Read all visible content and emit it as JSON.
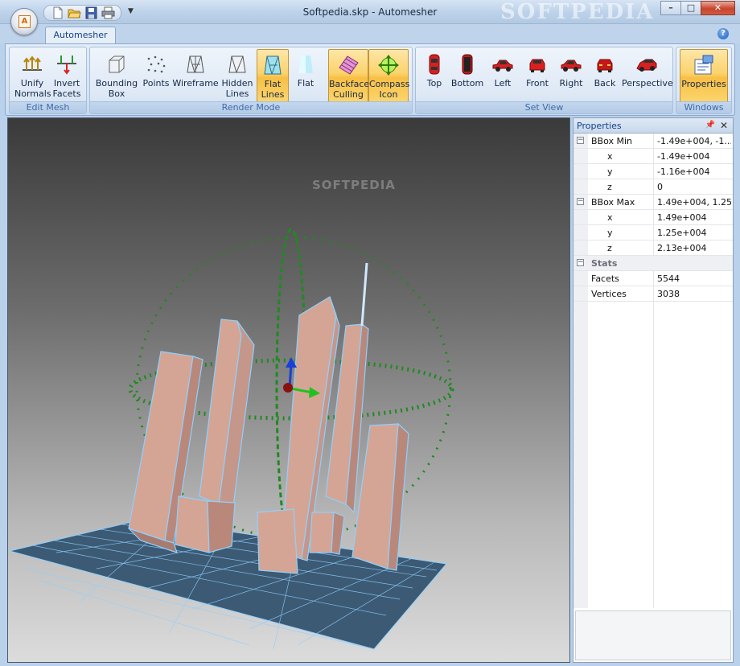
{
  "window": {
    "title": "Softpedia.skp - Automesher",
    "watermark": "SOFTPEDIA",
    "app_button_label": "A",
    "caption": {
      "minimize": "–",
      "maximize": "□",
      "close": "✕"
    }
  },
  "quick_access": [
    "new-doc-icon",
    "open-folder-icon",
    "save-icon",
    "print-icon"
  ],
  "ribbon": {
    "tab": "Automesher",
    "help": "?",
    "groups": {
      "edit_mesh": {
        "label": "Edit Mesh",
        "unify": {
          "line1": "Unify",
          "line2": "Normals"
        },
        "invert": {
          "line1": "Invert",
          "line2": "Facets"
        }
      },
      "render_mode": {
        "label": "Render Mode",
        "bbox": {
          "line1": "Bounding",
          "line2": "Box"
        },
        "points": {
          "line1": "Points"
        },
        "wireframe": {
          "line1": "Wireframe"
        },
        "hidden": {
          "line1": "Hidden",
          "line2": "Lines"
        },
        "flatlines": {
          "line1": "Flat",
          "line2": "Lines",
          "active": true
        },
        "flat": {
          "line1": "Flat"
        },
        "backface": {
          "line1": "Backface",
          "line2": "Culling",
          "active": true
        },
        "compass": {
          "line1": "Compass",
          "line2": "Icon",
          "active": true
        }
      },
      "set_view": {
        "label": "Set View",
        "top": "Top",
        "bottom": "Bottom",
        "left": "Left",
        "front": "Front",
        "right": "Right",
        "back": "Back",
        "perspective": "Perspective"
      },
      "windows": {
        "label": "Windows",
        "properties": {
          "line1": "Properties",
          "active": true
        }
      }
    }
  },
  "viewport": {
    "watermark": "SOFTPEDIA",
    "colors": {
      "building": "#d4a594",
      "edge": "#8fd0ff",
      "ground": "#3c5a74",
      "compass": "#1f8a1f"
    }
  },
  "properties": {
    "title": "Properties",
    "pin": "📌",
    "close": "✕",
    "rows": [
      {
        "type": "group",
        "toggle": "⊟",
        "key": "BBox Min",
        "value": "-1.49e+004, -1..."
      },
      {
        "type": "child",
        "key": "x",
        "value": "-1.49e+004"
      },
      {
        "type": "child",
        "key": "y",
        "value": "-1.16e+004"
      },
      {
        "type": "child",
        "key": "z",
        "value": "0"
      },
      {
        "type": "group",
        "toggle": "⊟",
        "key": "BBox Max",
        "value": "1.49e+004, 1.25..."
      },
      {
        "type": "child",
        "key": "x",
        "value": "1.49e+004"
      },
      {
        "type": "child",
        "key": "y",
        "value": "1.25e+004"
      },
      {
        "type": "child",
        "key": "z",
        "value": "2.13e+004"
      },
      {
        "type": "category",
        "toggle": "⊟",
        "key": "Stats",
        "value": ""
      },
      {
        "type": "item",
        "key": "Facets",
        "value": "5544"
      },
      {
        "type": "item",
        "key": "Vertices",
        "value": "3038"
      }
    ]
  }
}
